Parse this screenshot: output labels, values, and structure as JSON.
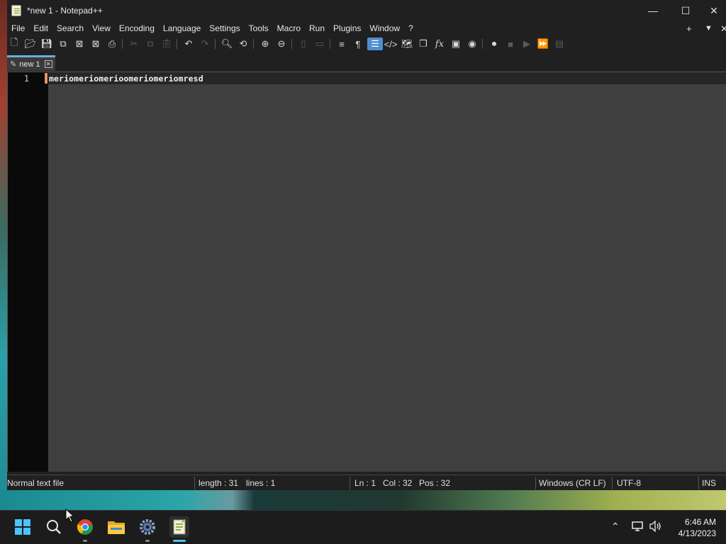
{
  "window": {
    "title": "*new 1 - Notepad++",
    "minimize_label": "—",
    "maximize_label": "☐",
    "close_label": "✕"
  },
  "menu": {
    "items": [
      "File",
      "Edit",
      "Search",
      "View",
      "Encoding",
      "Language",
      "Settings",
      "Tools",
      "Macro",
      "Run",
      "Plugins",
      "Window",
      "?"
    ],
    "right_plus": "+",
    "right_dropdown": "▼",
    "right_close": "✕"
  },
  "toolbar": {
    "icons": [
      "new-file-icon",
      "open-file-icon",
      "save-icon",
      "save-all-icon",
      "close-icon",
      "close-all-icon",
      "print-icon",
      "cut-icon",
      "copy-icon",
      "paste-icon",
      "undo-icon",
      "redo-icon",
      "find-icon",
      "replace-icon",
      "zoom-in-icon",
      "zoom-out-icon",
      "sync-vertical-icon",
      "sync-horizontal-icon",
      "word-wrap-icon",
      "show-all-chars-icon",
      "indent-guide-icon",
      "xml-tag-icon",
      "document-map-icon",
      "document-list-icon",
      "function-list-icon",
      "folder-as-workspace-icon",
      "monitoring-icon",
      "record-macro-icon",
      "stop-macro-icon",
      "play-macro-icon",
      "run-macro-multiple-icon",
      "save-macro-icon"
    ]
  },
  "tab": {
    "label": "new 1",
    "close_label": "✕"
  },
  "editor": {
    "line_number": "1",
    "line_text": "meriomeriomerioomeriomeriomresd"
  },
  "status": {
    "file_type": "Normal text file",
    "length": "length : 31",
    "lines": "lines : 1",
    "ln": "Ln : 1",
    "col": "Col : 32",
    "pos": "Pos : 32",
    "eol": "Windows (CR LF)",
    "encoding": "UTF-8",
    "mode": "INS"
  },
  "taskbar": {
    "time": "6:46 AM",
    "date": "4/13/2023"
  },
  "colors": {
    "accent": "#4f8ed0",
    "change_marker": "#e8925a",
    "tab_accent": "#6aaedc"
  }
}
